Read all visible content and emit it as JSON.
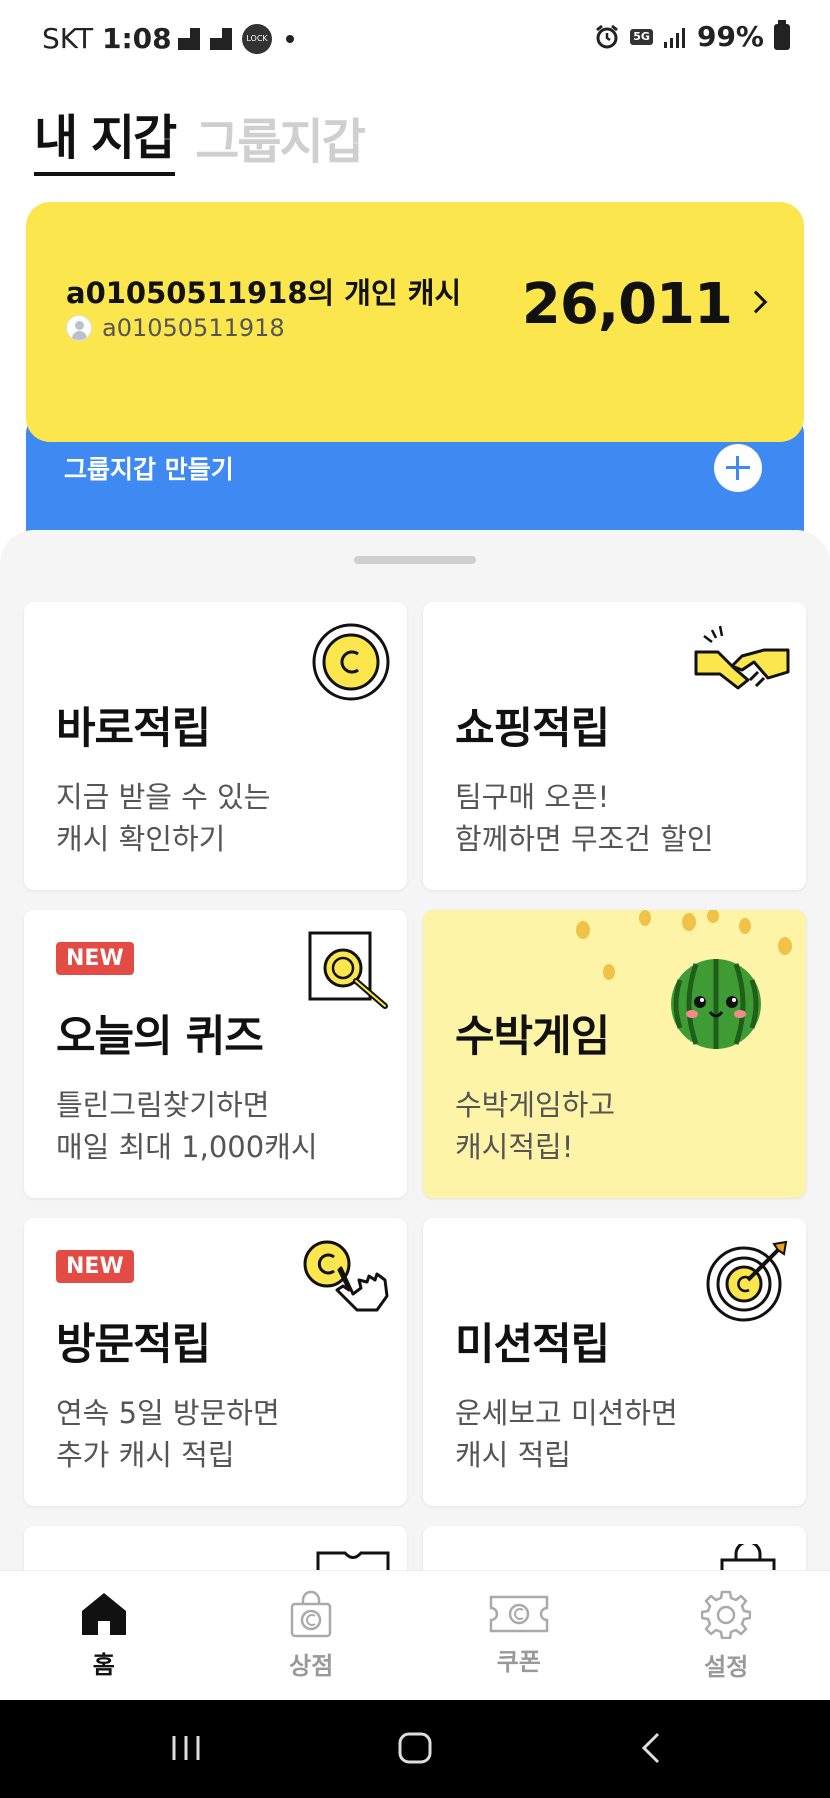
{
  "status_bar": {
    "carrier": "SKT",
    "time": "1:08",
    "lock_label": "LOCK",
    "network": "5G",
    "battery": "99%"
  },
  "wallet_tabs": {
    "active": "내 지갑",
    "inactive": "그룹지갑"
  },
  "cash_card": {
    "title": "a01050511918의 개인 캐시",
    "username": "a01050511918",
    "amount": "26,011"
  },
  "group_wallet": {
    "label": "그룹지갑 만들기"
  },
  "menu_cards": [
    {
      "title": "바로적립",
      "desc": "지금 받을 수 있는\n캐시 확인하기",
      "badge": "",
      "icon": "coin-icon"
    },
    {
      "title": "쇼핑적립",
      "desc": "팀구매 오픈!\n함께하면 무조건 할인",
      "badge": "",
      "icon": "handshake-icon"
    },
    {
      "title": "오늘의 퀴즈",
      "desc": "틀린그림찾기하면\n매일 최대 1,000캐시",
      "badge": "NEW",
      "icon": "magnifier-coin-icon"
    },
    {
      "title": "수박게임",
      "desc": "수박게임하고\n캐시적립!",
      "badge": "",
      "icon": "watermelon-icon"
    },
    {
      "title": "방문적립",
      "desc": "연속 5일 방문하면\n추가 캐시 적립",
      "badge": "NEW",
      "icon": "tap-coin-icon"
    },
    {
      "title": "미션적립",
      "desc": "운세보고 미션하면\n캐시 적립",
      "badge": "",
      "icon": "target-icon"
    }
  ],
  "bottom_nav": [
    {
      "label": "홈",
      "icon": "home-icon",
      "active": true
    },
    {
      "label": "상점",
      "icon": "shop-icon",
      "active": false
    },
    {
      "label": "쿠폰",
      "icon": "coupon-icon",
      "active": false
    },
    {
      "label": "설정",
      "icon": "gear-icon",
      "active": false
    }
  ],
  "colors": {
    "cash_card_bg": "#fbe64d",
    "group_card_bg": "#3e8af2",
    "badge_bg": "#e34b44",
    "game_card_bg": "#fdf4a7"
  }
}
